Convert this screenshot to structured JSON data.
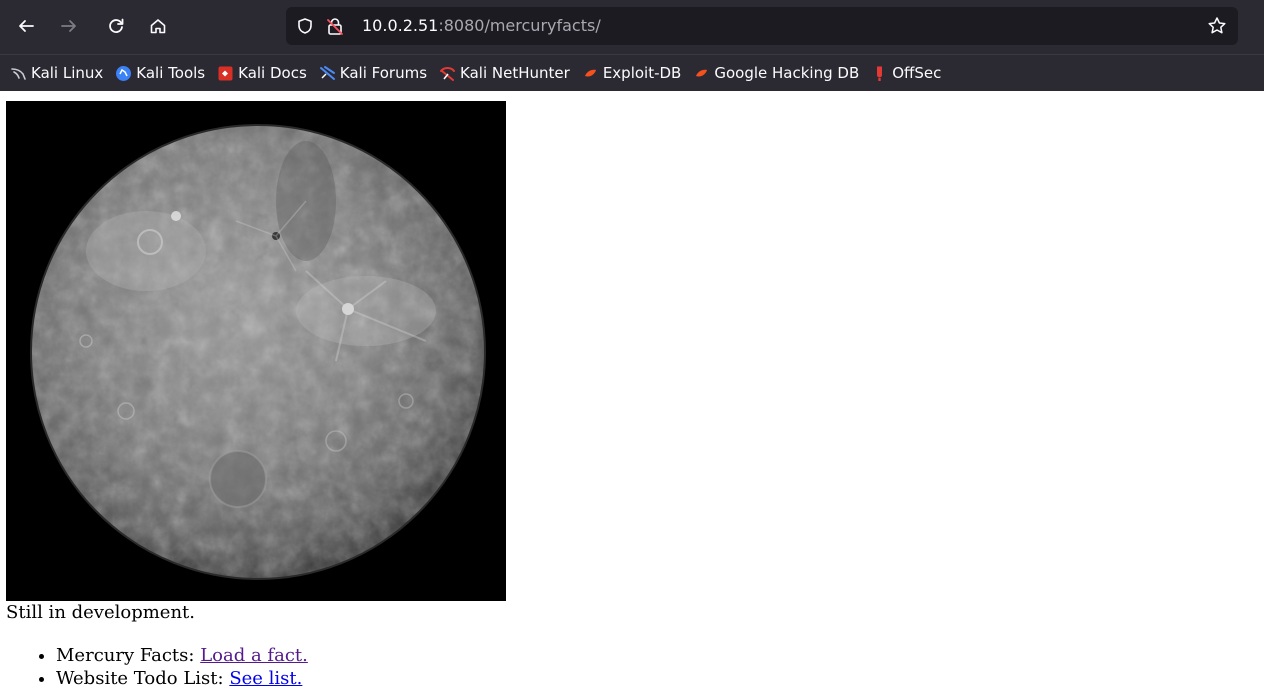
{
  "browser": {
    "url_host": "10.0.2.51",
    "url_rest": ":8080/mercuryfacts/",
    "nav": {
      "back_icon": "back-arrow-icon",
      "forward_icon": "forward-arrow-icon",
      "reload_icon": "reload-icon",
      "home_icon": "home-icon"
    },
    "bookmarks": [
      {
        "label": "Kali Linux",
        "icon": "kali-dragon-icon",
        "color": "#9aa0a6"
      },
      {
        "label": "Kali Tools",
        "icon": "kali-tools-icon",
        "color": "#3b82f6"
      },
      {
        "label": "Kali Docs",
        "icon": "kali-docs-icon",
        "color": "#d93025"
      },
      {
        "label": "Kali Forums",
        "icon": "kali-forums-icon",
        "color": "#4c8bf5"
      },
      {
        "label": "Kali NetHunter",
        "icon": "kali-nethunter-icon",
        "color": "#e53935"
      },
      {
        "label": "Exploit-DB",
        "icon": "exploit-db-icon",
        "color": "#f4511e"
      },
      {
        "label": "Google Hacking DB",
        "icon": "ghdb-icon",
        "color": "#f4511e"
      },
      {
        "label": "OffSec",
        "icon": "offsec-icon",
        "color": "#e53935"
      }
    ]
  },
  "page": {
    "status_text": "Still in development.",
    "links": [
      {
        "prefix": "Mercury Facts: ",
        "link_text": "Load a fact.",
        "visited": true
      },
      {
        "prefix": "Website Todo List: ",
        "link_text": "See list.",
        "visited": false
      }
    ]
  },
  "colors": {
    "chrome_bg": "#2b2a33",
    "url_bg": "#1c1b22",
    "visited_link": "#551a8b",
    "link": "#0000ee"
  }
}
